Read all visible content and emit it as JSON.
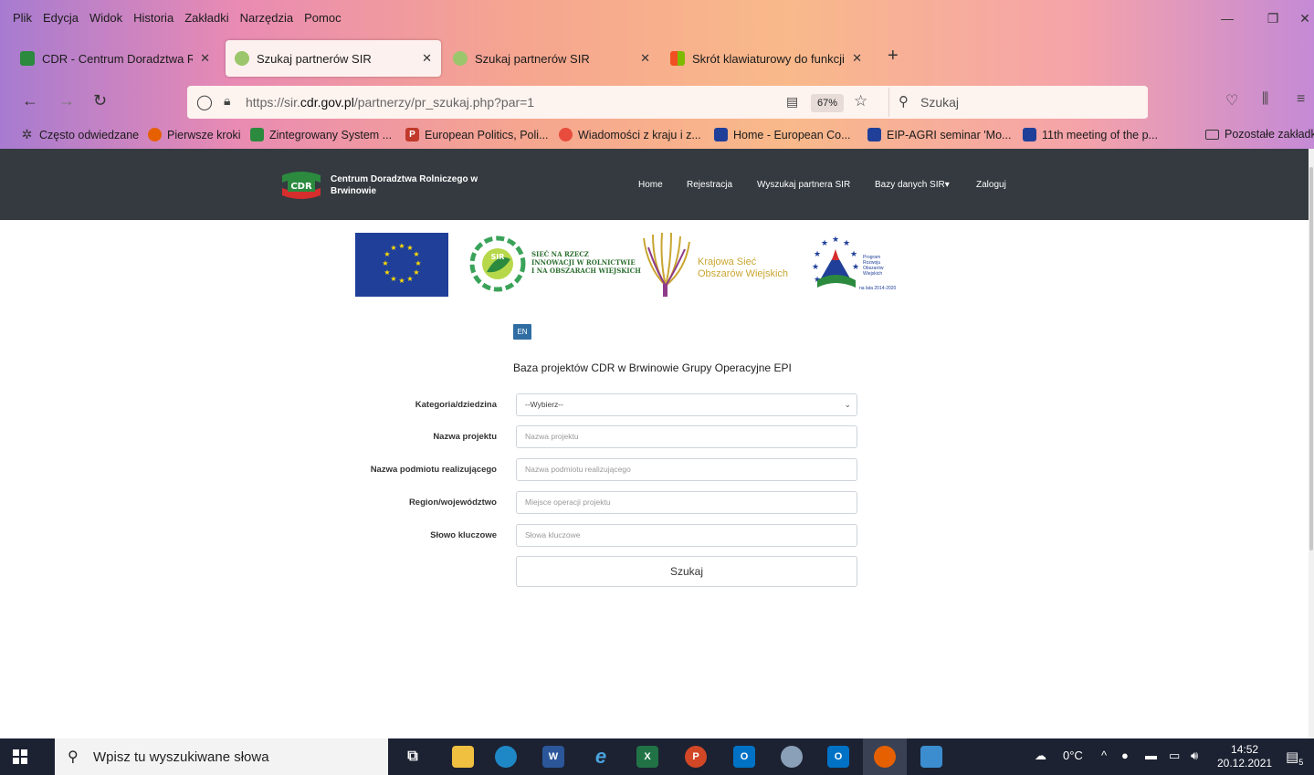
{
  "browser": {
    "menu": [
      "Plik",
      "Edycja",
      "Widok",
      "Historia",
      "Zakładki",
      "Narzędzia",
      "Pomoc"
    ],
    "tabs": [
      {
        "title": "CDR - Centrum Doradztwa Roln",
        "close": "✕"
      },
      {
        "title": "Szukaj partnerów SIR",
        "close": "✕"
      },
      {
        "title": "Szukaj partnerów SIR",
        "close": "✕"
      },
      {
        "title": "Skrót klawiaturowy do funkcji P",
        "close": "✕"
      }
    ],
    "url_prefix": "https://sir.",
    "url_domain": "cdr.gov.pl",
    "url_path": "/partnerzy/pr_szukaj.php?par=1",
    "zoom": "67%",
    "search_placeholder": "Szukaj",
    "bookmarks": [
      "Często odwiedzane",
      "Pierwsze kroki",
      "Zintegrowany System ...",
      "European Politics, Poli...",
      "Wiadomości z kraju i z...",
      "Home - European Co...",
      "EIP-AGRI seminar 'Mo...",
      "11th meeting of the p...",
      "Pozostałe zakładki"
    ]
  },
  "site": {
    "brand_line1": "Centrum Doradztwa Rolniczego w",
    "brand_line2": "Brwinowie",
    "logo_text": "CDR",
    "nav": [
      "Home",
      "Rejestracja",
      "Wyszukaj partnera SIR",
      "Bazy danych SIR▾",
      "Zaloguj"
    ],
    "sir_logo_label": "SIR",
    "sir_text": [
      "SIEĆ NA RZECZ",
      "INNOWACJI W ROLNICTWIE",
      "I NA OBSZARACH WIEJSKICH"
    ],
    "ksow_text": [
      "Krajowa Sieć",
      "Obszarów Wiejskich"
    ],
    "prow_text": [
      "Program",
      "Rozwoju",
      "Obszarów",
      "Wiejskich"
    ],
    "prow_date": "na lata 2014-2020",
    "lang": "EN",
    "heading": "Baza projektów CDR w Brwinowie Grupy Operacyjne EPI",
    "form": {
      "category_label": "Kategoria/dziedzina",
      "category_value": "--Wybierz--",
      "project_label": "Nazwa projektu",
      "project_placeholder": "Nazwa projektu",
      "entity_label": "Nazwa podmiotu realizującego",
      "entity_placeholder": "Nazwa podmiotu realizującego",
      "region_label": "Region/województwo",
      "region_placeholder": "Miejsce operacji projektu",
      "keywords_label": "Słowo kluczowe",
      "keywords_placeholder": "Słowa kluczowe",
      "submit": "Szukaj"
    }
  },
  "taskbar": {
    "search_placeholder": "Wpisz tu wyszukiwane słowa",
    "weather": "0°C",
    "time": "14:52",
    "date": "20.12.2021",
    "notifications": "5"
  },
  "colors": {
    "site_nav": "#343a40",
    "lang_button": "#2f6da3",
    "taskbar": "#1c2232"
  }
}
